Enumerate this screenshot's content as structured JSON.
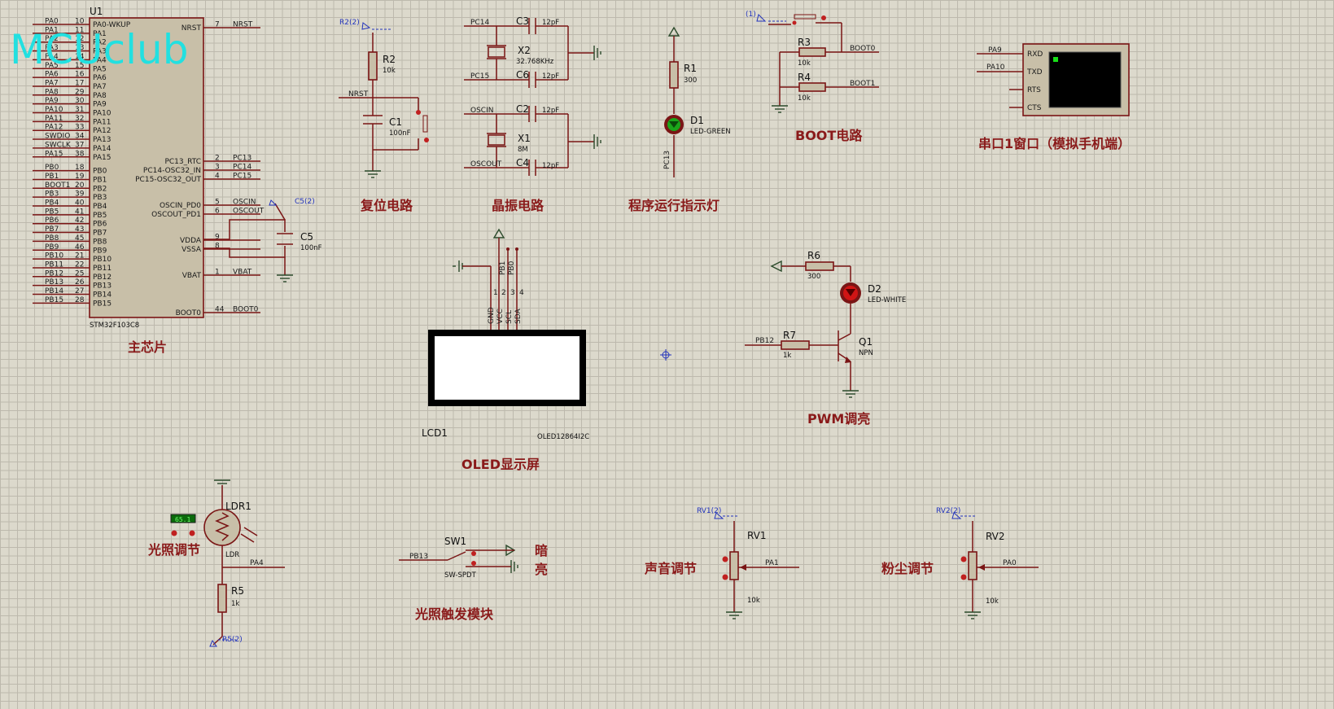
{
  "logo": "MCUclub",
  "sections": {
    "main_chip": "主芯片",
    "reset": "复位电路",
    "crystal": "晶振电路",
    "run_led": "程序运行指示灯",
    "boot": "BOOT电路",
    "serial": "串口1窗口（模拟手机端）",
    "oled": "OLED显示屏",
    "pwm": "PWM调亮",
    "light_adj": "光照调节",
    "light_trigger": "光照触发模块",
    "sound_adj": "声音调节",
    "dust_adj": "粉尘调节",
    "dark": "暗",
    "bright": "亮"
  },
  "mcu": {
    "ref": "U1",
    "part": "STM32F103C8",
    "left_pins": [
      {
        "net": "PA0",
        "num": "10",
        "name": "PA0-WKUP"
      },
      {
        "net": "PA1",
        "num": "11",
        "name": "PA1"
      },
      {
        "net": "PA2",
        "num": "12",
        "name": "PA2"
      },
      {
        "net": "PA3",
        "num": "13",
        "name": "PA3"
      },
      {
        "net": "PA4",
        "num": "14",
        "name": "PA4"
      },
      {
        "net": "PA5",
        "num": "15",
        "name": "PA5"
      },
      {
        "net": "PA6",
        "num": "16",
        "name": "PA6"
      },
      {
        "net": "PA7",
        "num": "17",
        "name": "PA7"
      },
      {
        "net": "PA8",
        "num": "29",
        "name": "PA8"
      },
      {
        "net": "PA9",
        "num": "30",
        "name": "PA9"
      },
      {
        "net": "PA10",
        "num": "31",
        "name": "PA10"
      },
      {
        "net": "PA11",
        "num": "32",
        "name": "PA11"
      },
      {
        "net": "PA12",
        "num": "33",
        "name": "PA12"
      },
      {
        "net": "SWDIO",
        "num": "34",
        "name": "PA13"
      },
      {
        "net": "SWCLK",
        "num": "37",
        "name": "PA14"
      },
      {
        "net": "PA15",
        "num": "38",
        "name": "PA15"
      },
      {
        "net": "PB0",
        "num": "18",
        "name": "PB0"
      },
      {
        "net": "PB1",
        "num": "19",
        "name": "PB1"
      },
      {
        "net": "BOOT1",
        "num": "20",
        "name": "PB2"
      },
      {
        "net": "PB3",
        "num": "39",
        "name": "PB3"
      },
      {
        "net": "PB4",
        "num": "40",
        "name": "PB4"
      },
      {
        "net": "PB5",
        "num": "41",
        "name": "PB5"
      },
      {
        "net": "PB6",
        "num": "42",
        "name": "PB6"
      },
      {
        "net": "PB7",
        "num": "43",
        "name": "PB7"
      },
      {
        "net": "PB8",
        "num": "45",
        "name": "PB8"
      },
      {
        "net": "PB9",
        "num": "46",
        "name": "PB9"
      },
      {
        "net": "PB10",
        "num": "21",
        "name": "PB10"
      },
      {
        "net": "PB11",
        "num": "22",
        "name": "PB11"
      },
      {
        "net": "PB12",
        "num": "25",
        "name": "PB12"
      },
      {
        "net": "PB13",
        "num": "26",
        "name": "PB13"
      },
      {
        "net": "PB14",
        "num": "27",
        "name": "PB14"
      },
      {
        "net": "PB15",
        "num": "28",
        "name": "PB15"
      }
    ],
    "right_pins": [
      {
        "name": "NRST",
        "num": "7",
        "net": "NRST"
      },
      {
        "name": "PC13_RTC",
        "num": "2",
        "net": "PC13"
      },
      {
        "name": "PC14-OSC32_IN",
        "num": "3",
        "net": "PC14"
      },
      {
        "name": "PC15-OSC32_OUT",
        "num": "4",
        "net": "PC15"
      },
      {
        "name": "OSCIN_PD0",
        "num": "5",
        "net": "OSCIN"
      },
      {
        "name": "OSCOUT_PD1",
        "num": "6",
        "net": "OSCOUT"
      },
      {
        "name": "VDDA",
        "num": "9",
        "net": ""
      },
      {
        "name": "VSSA",
        "num": "8",
        "net": ""
      },
      {
        "name": "VBAT",
        "num": "1",
        "net": "VBAT"
      },
      {
        "name": "BOOT0",
        "num": "44",
        "net": "BOOT0"
      }
    ]
  },
  "parts": {
    "c5": {
      "ref": "C5",
      "val": "100nF",
      "tag": "C5(2)"
    },
    "r2": {
      "ref": "R2",
      "val": "10k",
      "tag": "R2(2)",
      "net": "NRST"
    },
    "c1": {
      "ref": "C1",
      "val": "100nF"
    },
    "c3": {
      "ref": "C3",
      "val": "12pF",
      "net": "PC14"
    },
    "x2": {
      "ref": "X2",
      "val": "32.768KHz"
    },
    "c6": {
      "ref": "C6",
      "val": "12pF",
      "net": "PC15"
    },
    "c2": {
      "ref": "C2",
      "val": "12pF",
      "net": "OSCIN"
    },
    "x1": {
      "ref": "X1",
      "val": "8M"
    },
    "c4": {
      "ref": "C4",
      "val": "12pF",
      "net": "OSCOUT"
    },
    "r1": {
      "ref": "R1",
      "val": "300"
    },
    "d1": {
      "ref": "D1",
      "val": "LED-GREEN",
      "net": "PC13"
    },
    "r3": {
      "ref": "R3",
      "val": "10k",
      "net": "BOOT0",
      "tag": "(1)"
    },
    "r4": {
      "ref": "R4",
      "val": "10k",
      "net": "BOOT1"
    },
    "term": {
      "pins": [
        "RXD",
        "TXD",
        "RTS",
        "CTS"
      ],
      "nets": [
        "PA9",
        "PA10"
      ]
    },
    "oled": {
      "ref": "LCD1",
      "val": "OLED12864I2C",
      "pins": [
        "GND",
        "VCC",
        "SCL",
        "SDA"
      ],
      "nums": [
        "1",
        "2",
        "3",
        "4"
      ],
      "nets": [
        "PB1",
        "PB0"
      ]
    },
    "r6": {
      "ref": "R6",
      "val": "300"
    },
    "d2": {
      "ref": "D2",
      "val": "LED-WHITE"
    },
    "r7": {
      "ref": "R7",
      "val": "1k",
      "net": "PB12"
    },
    "q1": {
      "ref": "Q1",
      "val": "NPN"
    },
    "ldr": {
      "ref": "LDR1",
      "val": "LDR",
      "reading": "65.1",
      "net": "PA4"
    },
    "r5": {
      "ref": "R5",
      "val": "1k",
      "tag": "R5(2)"
    },
    "sw1": {
      "ref": "SW1",
      "val": "SW-SPDT",
      "net": "PB13"
    },
    "rv1": {
      "ref": "RV1",
      "val": "10k",
      "tag": "RV1(2)",
      "net": "PA1"
    },
    "rv2": {
      "ref": "RV2",
      "val": "10k",
      "tag": "RV2(2)",
      "net": "PA0"
    }
  },
  "colors": {
    "wire": "#7a1515",
    "caption": "#8a1a1a",
    "logo": "#22e0e0",
    "grid": "#bdb9ad",
    "probe_tag": "#2233bb"
  }
}
